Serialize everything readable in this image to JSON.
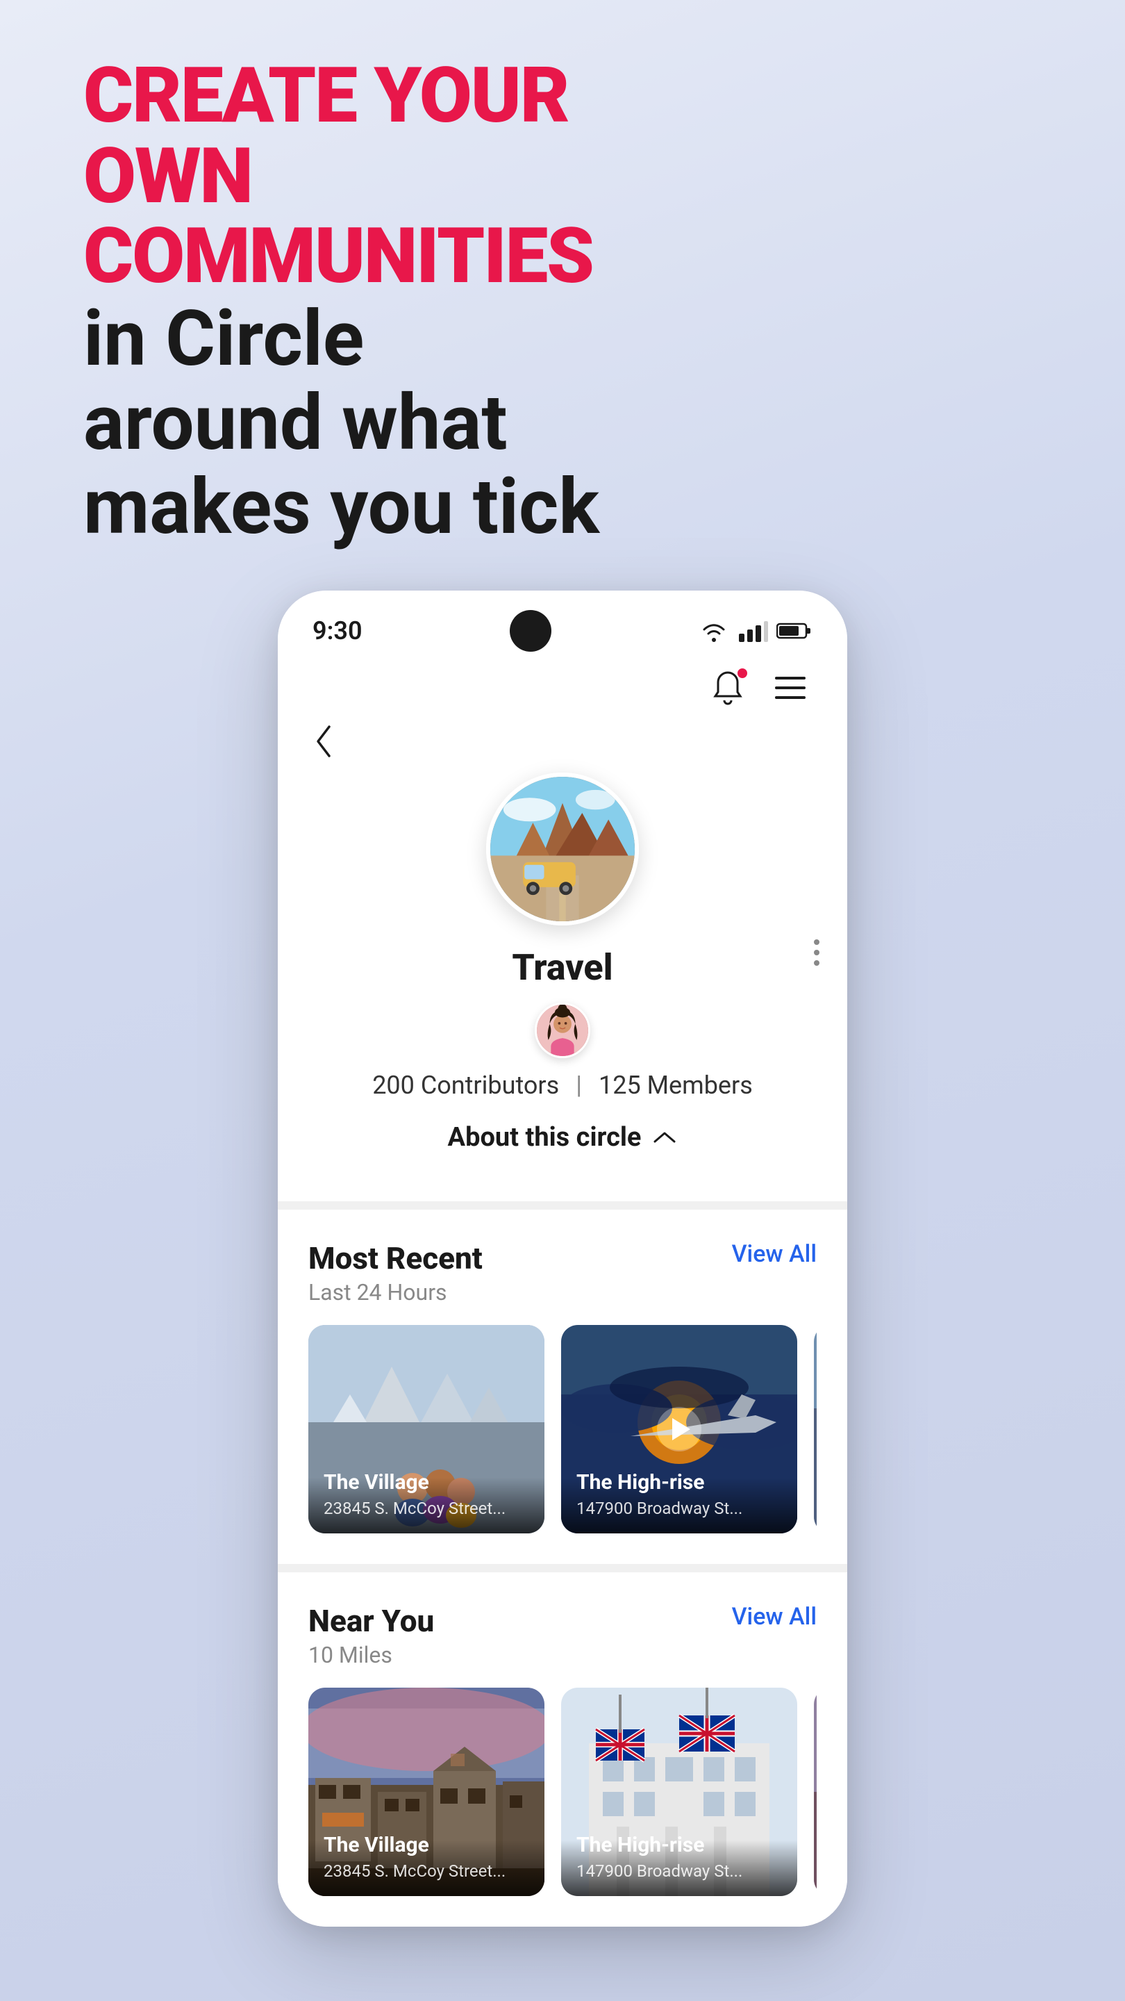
{
  "headline": {
    "bold_part": "CREATE YOUR OWN COMMUNITIES",
    "normal_part": "in Circle around what makes you tick"
  },
  "status_bar": {
    "time": "9:30"
  },
  "nav": {
    "bell_label": "notifications",
    "menu_label": "menu"
  },
  "profile": {
    "title": "Travel",
    "contributors": "200 Contributors",
    "divider": "|",
    "members": "125 Members",
    "about_label": "About this circle"
  },
  "most_recent": {
    "title": "Most Recent",
    "subtitle": "Last 24 Hours",
    "view_all": "View All",
    "cards": [
      {
        "title": "The Village",
        "subtitle": "23845 S. McCoy Street..."
      },
      {
        "title": "The High-rise",
        "subtitle": "147900 Broadway St..."
      }
    ]
  },
  "near_you": {
    "title": "Near You",
    "subtitle": "10 Miles",
    "view_all": "View All",
    "cards": [
      {
        "title": "The Village",
        "subtitle": "23845 S. McCoy Street..."
      },
      {
        "title": "The High-rise",
        "subtitle": "147900 Broadway St..."
      }
    ]
  }
}
